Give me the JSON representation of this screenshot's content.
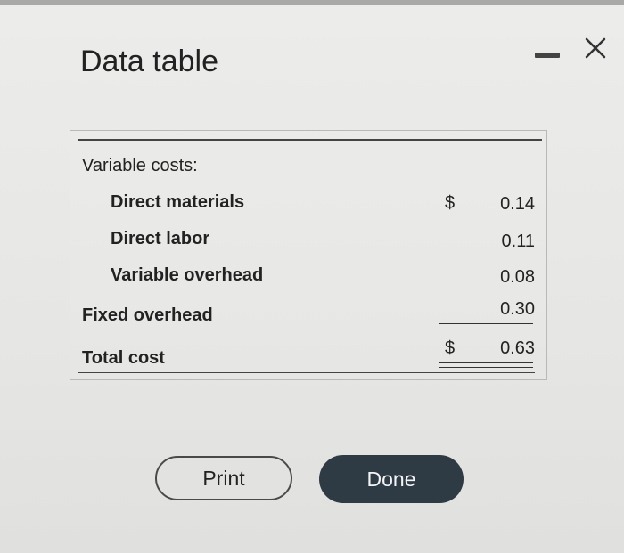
{
  "dialog": {
    "title": "Data table",
    "minimize_icon": "minimize-icon",
    "close_icon": "close-icon"
  },
  "table": {
    "section_label": "Variable costs:",
    "rows": [
      {
        "label": "Direct materials",
        "currency": "$",
        "value": "0.14"
      },
      {
        "label": "Direct labor",
        "currency": "",
        "value": "0.11"
      },
      {
        "label": "Variable overhead",
        "currency": "",
        "value": "0.08"
      },
      {
        "label": "Fixed overhead",
        "currency": "",
        "value": "0.30"
      }
    ],
    "total": {
      "label": "Total cost",
      "currency": "$",
      "value": "0.63"
    }
  },
  "buttons": {
    "print_label": "Print",
    "done_label": "Done"
  },
  "colors": {
    "done_button_bg": "#2f3b44",
    "dialog_bg": "#e8e8e6"
  }
}
